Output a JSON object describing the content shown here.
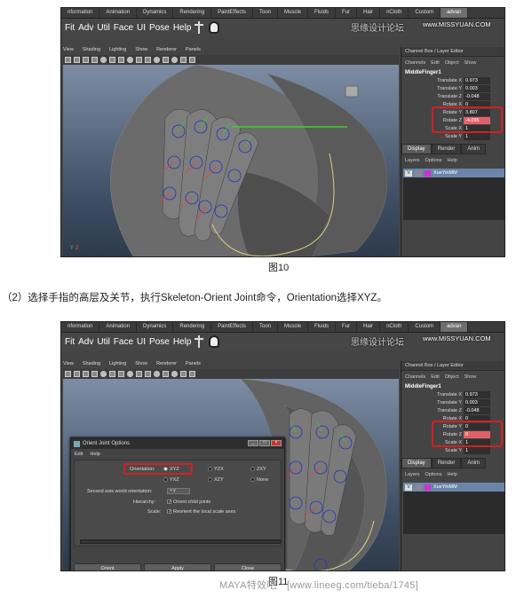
{
  "shelf_tabs": [
    "nformation",
    "Animation",
    "Dynamics",
    "Rendering",
    "PaintEffects",
    "Toon",
    "Muscle",
    "Fluids",
    "Fur",
    "Hair",
    "nCloth",
    "Custom",
    "advan"
  ],
  "shelf_tabs_2": [
    "nformation",
    "Animation",
    "Dynamics",
    "Rendering",
    "PaintEffects",
    "Toon",
    "Muscle",
    "Fluids",
    "Fur",
    "Hair",
    "nCloth",
    "Custom",
    "advan"
  ],
  "shelf_menu": [
    "Fit",
    "Adv",
    "Util",
    "Face",
    "UI",
    "Pose",
    "Help"
  ],
  "viewport_menu": [
    "View",
    "Shading",
    "Lighting",
    "Show",
    "Renderer",
    "Panels"
  ],
  "watermark_cn": "思缘设计论坛",
  "watermark_site": "www.MISSYUAN.COM",
  "channel_box": {
    "title": "Channel Box / Layer Editor",
    "menus": [
      "Channels",
      "Edit",
      "Object",
      "Show"
    ],
    "object_name": "MiddleFinger1"
  },
  "attrs_1": [
    {
      "name": "Translate X",
      "value": "0.973"
    },
    {
      "name": "Translate Y",
      "value": "0.003"
    },
    {
      "name": "Translate Z",
      "value": "-0.048"
    },
    {
      "name": "Rotate X",
      "value": "0"
    },
    {
      "name": "Rotate Y",
      "value": "3.807"
    },
    {
      "name": "Rotate Z",
      "value": "-4.095"
    },
    {
      "name": "Scale X",
      "value": "1"
    },
    {
      "name": "Scale Y",
      "value": "1"
    }
  ],
  "attrs_2": [
    {
      "name": "Translate X",
      "value": "0.973"
    },
    {
      "name": "Translate Y",
      "value": "0.003"
    },
    {
      "name": "Translate Z",
      "value": "-0.048"
    },
    {
      "name": "Rotate X",
      "value": "0"
    },
    {
      "name": "Rotate Y",
      "value": "0"
    },
    {
      "name": "Rotate Z",
      "value": "0"
    },
    {
      "name": "Scale X",
      "value": "1"
    },
    {
      "name": "Scale Y",
      "value": "1"
    }
  ],
  "display_tabs": [
    "Display",
    "Render",
    "Anim"
  ],
  "layer_menus": [
    "Layers",
    "Options",
    "Help"
  ],
  "layer_name": "XueYinMM",
  "layer_v": "V",
  "caption_1": "图10",
  "instruction": "（2）选择手指的高层及关节，执行Skeleton-Orient Joint命令，Orientation选择XYZ。",
  "caption_2": "图11",
  "dialog": {
    "title": "Orient Joint Options",
    "menus": [
      "Edit",
      "Help"
    ],
    "orientation_label": "Orientation:",
    "orientation_options": [
      "XYZ",
      "YZX",
      "ZXY",
      "YXZ",
      "XZY",
      "None"
    ],
    "second_axis_label": "Second axis world orientation:",
    "second_axis_value": "+ y",
    "hierarchy_label": "Hierarchy:",
    "hierarchy_value": "Orient child joints",
    "scale_label": "Scale:",
    "scale_value": "Reorient the local scale axes",
    "buttons": [
      "Orient",
      "Apply",
      "Close"
    ]
  },
  "footer_watermark": "MAYA特效吧　[www.lineeg.com/tieba/1745]"
}
